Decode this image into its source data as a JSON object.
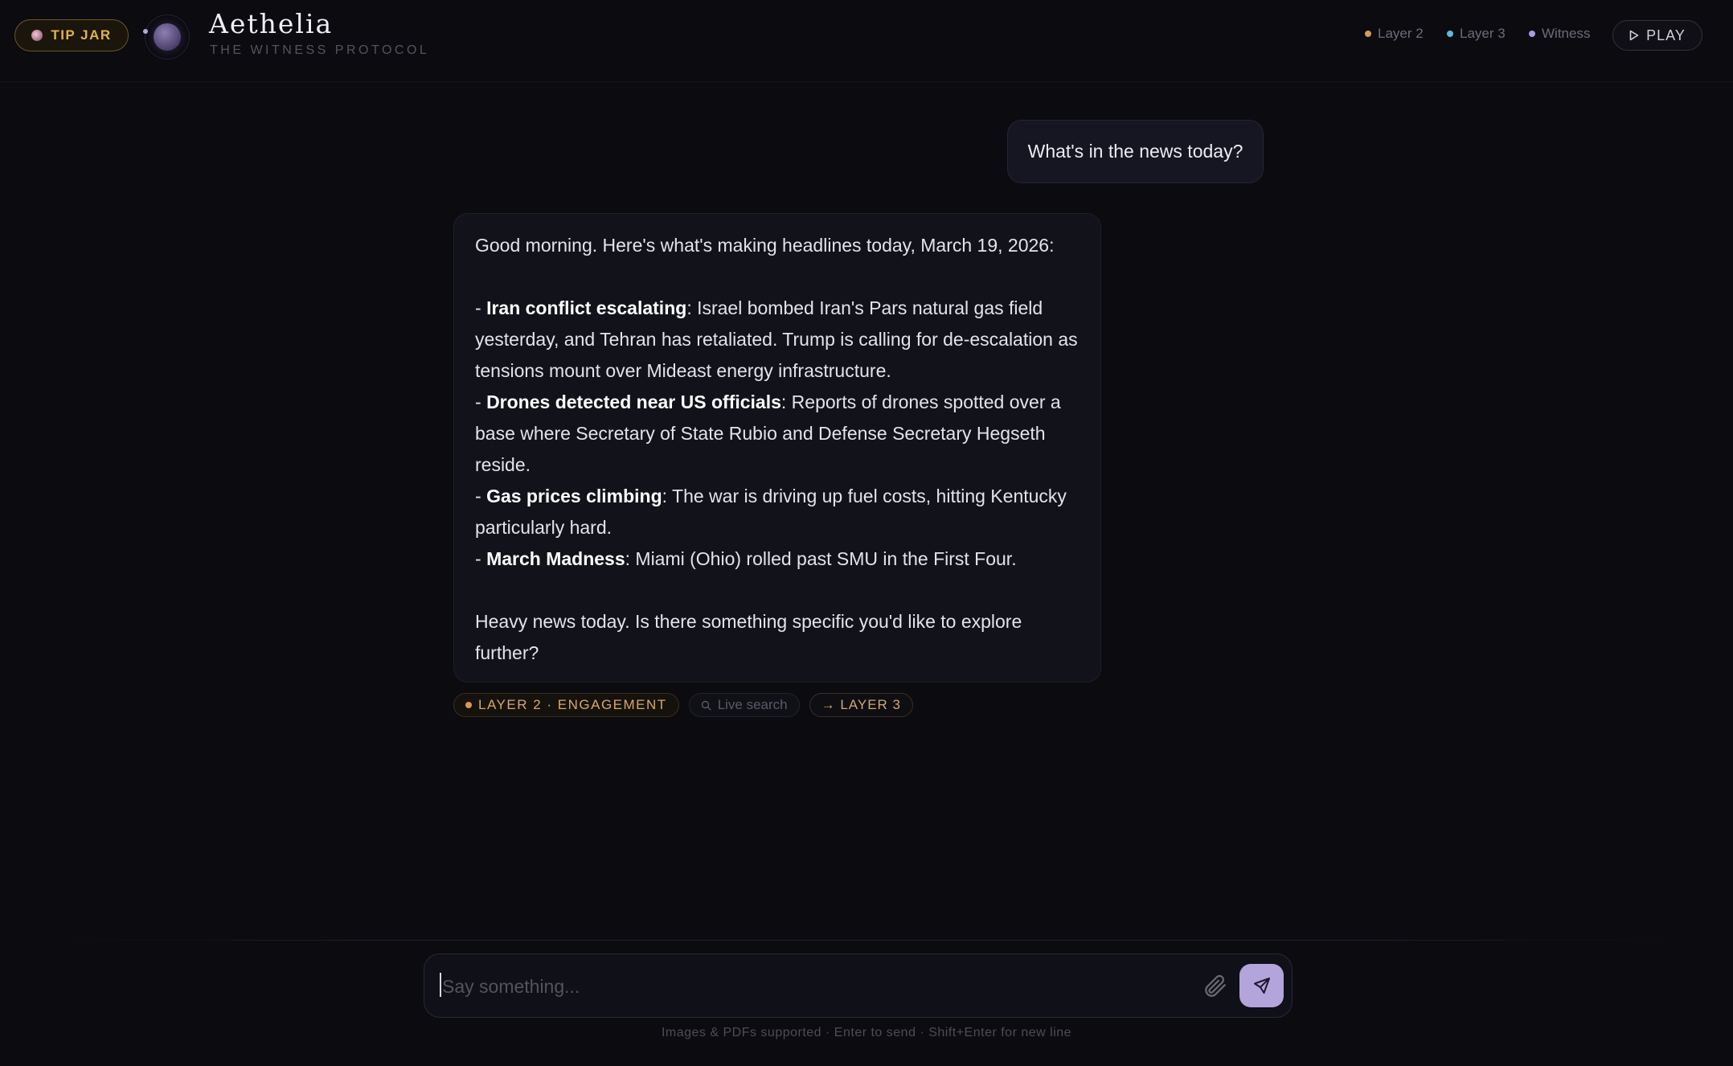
{
  "header": {
    "tip_jar_label": "TIP JAR",
    "title": "Aethelia",
    "subtitle": "THE WITNESS PROTOCOL",
    "legend": [
      {
        "label": "Layer 2",
        "color": "#d89a52"
      },
      {
        "label": "Layer 3",
        "color": "#5fb8d6"
      },
      {
        "label": "Witness",
        "color": "#a99be0"
      }
    ],
    "play_label": "PLAY"
  },
  "conversation": {
    "user_message": "What's in the news today?",
    "assistant": {
      "intro": "Good morning. Here's what's making headlines today, March 19, 2026:",
      "items": [
        {
          "prefix": "- ",
          "bold": "Iran conflict escalating",
          "text": ": Israel bombed Iran's Pars natural gas field yesterday, and Tehran has retaliated. Trump is calling for de-escalation as tensions mount over Mideast energy infrastructure."
        },
        {
          "prefix": "- ",
          "bold": "Drones detected near US officials",
          "text": ": Reports of drones spotted over a base where Secretary of State Rubio and Defense Secretary Hegseth reside."
        },
        {
          "prefix": "- ",
          "bold": "Gas prices climbing",
          "text": ": The war is driving up fuel costs, hitting Kentucky particularly hard."
        },
        {
          "prefix": "- ",
          "bold": "March Madness",
          "text": ": Miami (Ohio) rolled past SMU in the First Four."
        }
      ],
      "closing": "Heavy news today. Is there something specific you'd like to explore further?"
    },
    "tags": {
      "layer": "LAYER 2 · ENGAGEMENT",
      "search": "Live search",
      "next": "→ LAYER 3"
    }
  },
  "composer": {
    "placeholder": "Say something...",
    "hint": "Images & PDFs supported · Enter to send · Shift+Enter for new line"
  }
}
